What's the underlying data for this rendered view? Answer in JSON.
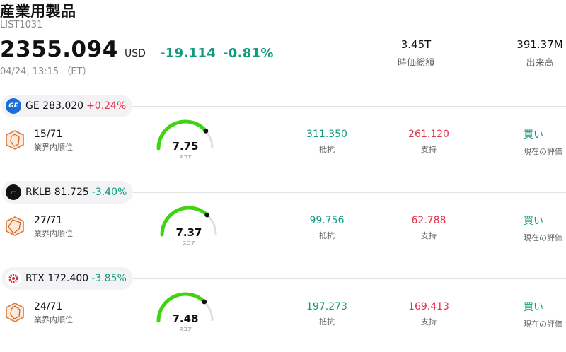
{
  "header": {
    "title": "産業用製品",
    "code": "LIST1031",
    "price": "2355.094",
    "currency": "USD",
    "change": "-19.114",
    "change_pct": "-0.81%",
    "timestamp": "04/24, 13:15 （ET）"
  },
  "stats": {
    "market_cap": {
      "value": "3.45T",
      "label": "時価総額"
    },
    "volume": {
      "value": "391.37M",
      "label": "出来高"
    }
  },
  "colors": {
    "up": "#e0334c",
    "down": "#129a7e",
    "gauge": "#3ed40f"
  },
  "stocks": [
    {
      "ticker": "GE",
      "price": "283.020",
      "change_pct": "+0.24%",
      "direction": "up",
      "logo_icon": "ge-logo-icon",
      "rank": "15/71",
      "rank_label": "業界内順位",
      "score": "7.75",
      "score_value": 7.75,
      "score_label": "スコア",
      "resistance": "311.350",
      "resistance_label": "抵抗",
      "support": "261.120",
      "support_label": "支持",
      "rating": "買い",
      "rating_label": "現在の評価"
    },
    {
      "ticker": "RKLB",
      "price": "81.725",
      "change_pct": "-3.40%",
      "direction": "down",
      "logo_icon": "rklb-logo-icon",
      "rank": "27/71",
      "rank_label": "業界内順位",
      "score": "7.37",
      "score_value": 7.37,
      "score_label": "スコア",
      "resistance": "99.756",
      "resistance_label": "抵抗",
      "support": "62.788",
      "support_label": "支持",
      "rating": "買い",
      "rating_label": "現在の評価"
    },
    {
      "ticker": "RTX",
      "price": "172.400",
      "change_pct": "-3.85%",
      "direction": "down",
      "logo_icon": "rtx-logo-icon",
      "rank": "24/71",
      "rank_label": "業界内順位",
      "score": "7.48",
      "score_value": 7.48,
      "score_label": "スコア",
      "resistance": "197.273",
      "resistance_label": "抵抗",
      "support": "169.413",
      "support_label": "支持",
      "rating": "買い",
      "rating_label": "現在の評価"
    }
  ]
}
